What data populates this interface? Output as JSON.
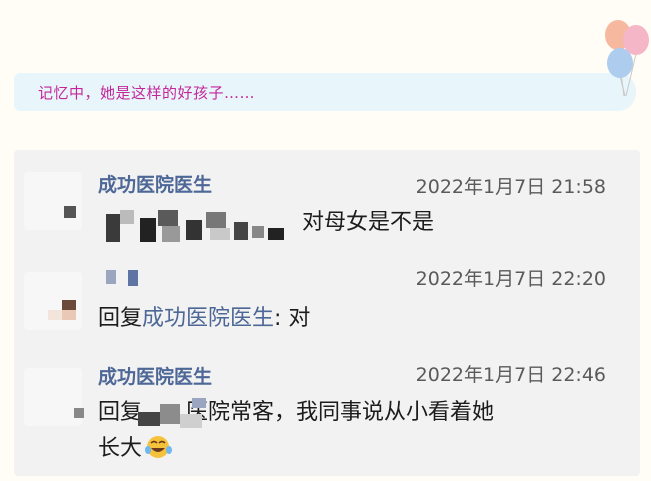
{
  "banner": {
    "text": "记忆中，她是这样的好孩子……"
  },
  "comments": [
    {
      "sender": "成功医院医生",
      "time": "2022年1月7日 21:58",
      "text": "对母女是不是"
    },
    {
      "sender": "",
      "time": "2022年1月7日 22:20",
      "reply_prefix": "回复",
      "reply_target": "成功医院医生",
      "text": ": 对"
    },
    {
      "sender": "成功医院医生",
      "time": "2022年1月7日 22:46",
      "reply_prefix": "回复",
      "text_line1": "医院常客，我同事说从小看着她",
      "text_line2": "长大"
    }
  ],
  "colors": {
    "banner_text": "#c4269a",
    "sender": "#4d6797",
    "banner_bg": "#e8f6fb"
  },
  "icons": [
    "balloons-icon",
    "laughing-tears-emoji-icon"
  ]
}
